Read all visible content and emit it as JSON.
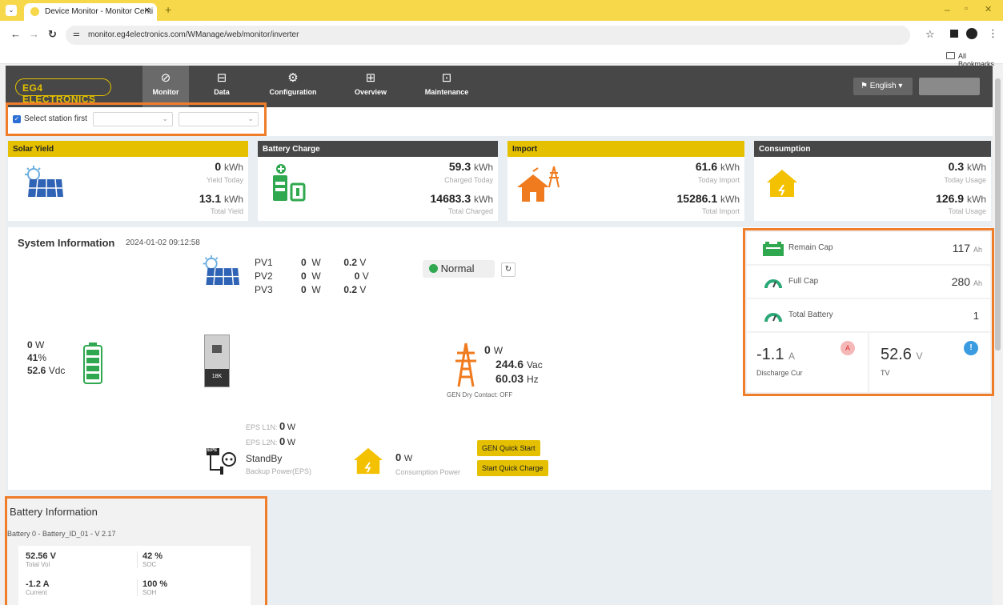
{
  "browser": {
    "tab_title": "Device Monitor - Monitor Centi",
    "new_tab": "+",
    "url": "monitor.eg4electronics.com/WManage/web/monitor/inverter",
    "bookmarks": "All Bookmarks"
  },
  "header": {
    "logo": "EG4 ELECTRONICS",
    "nav": [
      {
        "label": "Monitor",
        "icon": "⊘"
      },
      {
        "label": "Data",
        "icon": "⊟"
      },
      {
        "label": "Configuration",
        "icon": "⚙"
      },
      {
        "label": "Overview",
        "icon": "⊞"
      },
      {
        "label": "Maintenance",
        "icon": "⊡"
      }
    ],
    "language": "English"
  },
  "station": {
    "label": "Select station first",
    "select1": "",
    "select2": ""
  },
  "cards": {
    "solar": {
      "title": "Solar Yield",
      "v1": "0",
      "u1": "kWh",
      "l1": "Yield Today",
      "v2": "13.1",
      "u2": "kWh",
      "l2": "Total Yield"
    },
    "battery": {
      "title": "Battery Charge",
      "v1": "59.3",
      "u1": "kWh",
      "l1": "Charged Today",
      "v2": "14683.3",
      "u2": "kWh",
      "l2": "Total Charged"
    },
    "import": {
      "title": "Import",
      "v1": "61.6",
      "u1": "kWh",
      "l1": "Today Import",
      "v2": "15286.1",
      "u2": "kWh",
      "l2": "Total Import"
    },
    "consumption": {
      "title": "Consumption",
      "v1": "0.3",
      "u1": "kWh",
      "l1": "Today Usage",
      "v2": "126.9",
      "u2": "kWh",
      "l2": "Total Usage"
    }
  },
  "system": {
    "title": "System Information",
    "timestamp": "2024-01-02 09:12:58",
    "pv": [
      {
        "name": "PV1",
        "w": "0",
        "wu": "W",
        "v": "0.2",
        "vu": "V"
      },
      {
        "name": "PV2",
        "w": "0",
        "wu": "W",
        "v": "0",
        "vu": "V"
      },
      {
        "name": "PV3",
        "w": "0",
        "wu": "W",
        "v": "0.2",
        "vu": "V"
      }
    ],
    "status": "Normal",
    "battery": {
      "power": "0",
      "power_unit": "W",
      "soc": "41",
      "soc_unit": "%",
      "voltage": "52.6",
      "voltage_unit": "Vdc"
    },
    "inverter_label": "18K",
    "grid": {
      "power": "0",
      "power_unit": "W",
      "voltage": "244.6",
      "voltage_unit": "Vac",
      "freq": "60.03",
      "freq_unit": "Hz",
      "dry_contact": "GEN Dry Contact: OFF"
    },
    "eps": {
      "l1_label": "EPS L1N:",
      "l1": "0",
      "l1_unit": "W",
      "l2_label": "EPS L2N:",
      "l2": "0",
      "l2_unit": "W",
      "state": "StandBy",
      "state_label": "Backup Power(EPS)",
      "icon_text": "EPS"
    },
    "consumption": {
      "power": "0",
      "unit": "W",
      "label": "Consumption Power"
    },
    "buttons": {
      "gen_quick_start": "GEN Quick Start",
      "start_quick_charge": "Start Quick Charge"
    }
  },
  "battery_panel": {
    "remain_cap": {
      "label": "Remain Cap",
      "value": "117",
      "unit": "Ah"
    },
    "full_cap": {
      "label": "Full Cap",
      "value": "280",
      "unit": "Ah"
    },
    "total_battery": {
      "label": "Total Battery",
      "value": "1"
    },
    "discharge": {
      "value": "-1.1",
      "unit": "A",
      "label": "Discharge Cur",
      "badge": "A"
    },
    "tv": {
      "value": "52.6",
      "unit": "V",
      "label": "TV",
      "badge": "!"
    }
  },
  "battery_info": {
    "title": "Battery Information",
    "subtitle": "Battery 0 - Battery_ID_01 - V 2.17",
    "items": [
      {
        "value": "52.56 V",
        "label": "Total Vol"
      },
      {
        "value": "42 %",
        "label": "SOC"
      },
      {
        "value": "-1.2 A",
        "label": "Current"
      },
      {
        "value": "100 %",
        "label": "SOH"
      }
    ]
  },
  "colors": {
    "accent": "#e4c000",
    "highlight": "#ef7d2a",
    "nav": "#474747",
    "green": "#2fa84f",
    "orange_icon": "#f07b1e"
  }
}
